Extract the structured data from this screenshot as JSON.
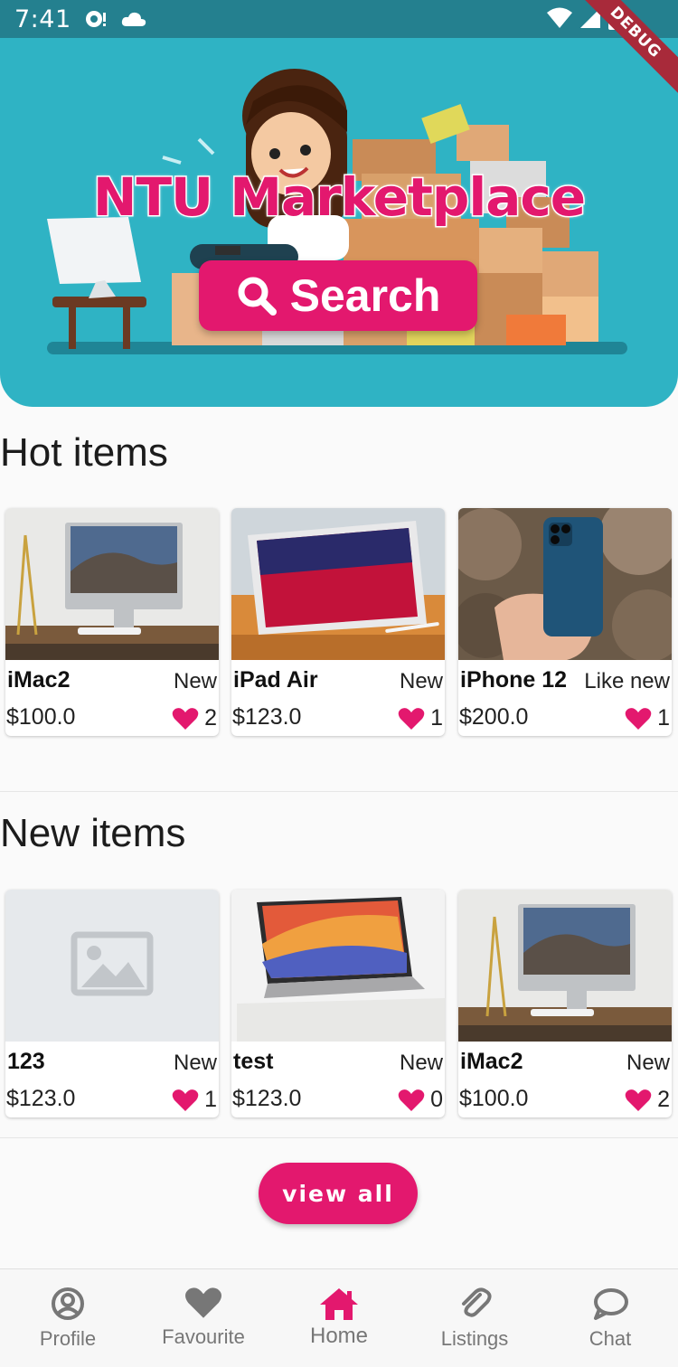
{
  "status_bar": {
    "time": "7:41"
  },
  "debug_banner": "DEBUG",
  "hero": {
    "title": "NTU Marketplace",
    "search_label": "Search"
  },
  "hot_items": {
    "title": "Hot items",
    "items": [
      {
        "name": "iMac2",
        "condition": "New",
        "price": "$100.0",
        "likes": "2",
        "image": "imac-photo"
      },
      {
        "name": "iPad Air",
        "condition": "New",
        "price": "$123.0",
        "likes": "1",
        "image": "ipad-photo"
      },
      {
        "name": "iPhone 12",
        "condition": "Like new",
        "price": "$200.0",
        "likes": "1",
        "image": "iphone-photo"
      }
    ]
  },
  "new_items": {
    "title": "New items",
    "items": [
      {
        "name": "123",
        "condition": "New",
        "price": "$123.0",
        "likes": "1",
        "image": "placeholder-image"
      },
      {
        "name": "test",
        "condition": "New",
        "price": "$123.0",
        "likes": "0",
        "image": "macbook-photo"
      },
      {
        "name": "iMac2",
        "condition": "New",
        "price": "$100.0",
        "likes": "2",
        "image": "imac-photo"
      }
    ]
  },
  "view_all_label": "view all",
  "bottom_nav": {
    "items": [
      {
        "label": "Profile",
        "icon": "profile-icon"
      },
      {
        "label": "Favourite",
        "icon": "heart-icon"
      },
      {
        "label": "Home",
        "icon": "home-icon",
        "active": true
      },
      {
        "label": "Listings",
        "icon": "paperclip-icon"
      },
      {
        "label": "Chat",
        "icon": "chat-icon"
      }
    ]
  },
  "colors": {
    "accent": "#e3186e",
    "hero_bg": "#2fb3c4",
    "status_bar": "#24808f"
  }
}
